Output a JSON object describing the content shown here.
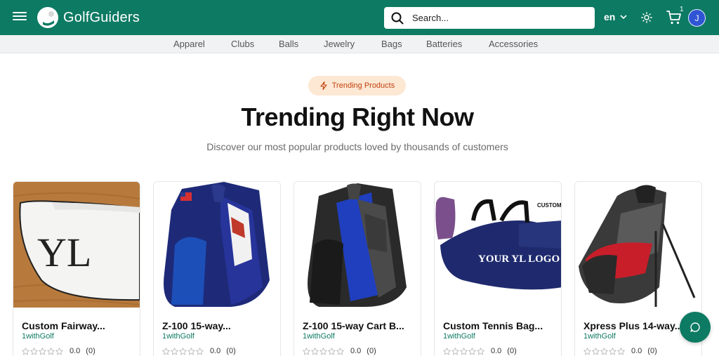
{
  "header": {
    "brand": "GolfGuiders",
    "search_placeholder": "Search...",
    "language": "en",
    "cart_count": "1",
    "avatar_initial": "J",
    "brand_color": "#0d7a63"
  },
  "categories": [
    "Apparel",
    "Clubs",
    "Balls",
    "Jewelry",
    "Bags",
    "Batteries",
    "Accessories"
  ],
  "hero": {
    "badge": "Trending Products",
    "title": "Trending Right Now",
    "subtitle": "Discover our most popular products loved by thousands of customers"
  },
  "products": [
    {
      "name": "Custom Fairway...",
      "brand": "1withGolf",
      "rating": "0.0",
      "reviews": "(0)",
      "image": "headcover-photo"
    },
    {
      "name": "Z-100 15-way...",
      "brand": "1withGolf",
      "rating": "0.0",
      "reviews": "(0)",
      "image": "navy-cart-bag"
    },
    {
      "name": "Z-100 15-way Cart B...",
      "brand": "1withGolf",
      "rating": "0.0",
      "reviews": "(0)",
      "image": "blue-black-cart-bag"
    },
    {
      "name": "Custom Tennis Bag...",
      "brand": "1withGolf",
      "rating": "0.0",
      "reviews": "(0)",
      "image": "tennis-bag",
      "image_text": {
        "top": "CUSTOM",
        "logo": "YOUR YL LOGO"
      }
    },
    {
      "name": "Xpress Plus 14-way...",
      "brand": "1withGolf",
      "rating": "0.0",
      "reviews": "(0)",
      "image": "red-stand-bag"
    }
  ],
  "icons": [
    "menu-icon",
    "search-icon",
    "chevron-down-icon",
    "sun-icon",
    "cart-icon",
    "sparkle-icon",
    "star-icon",
    "chat-icon"
  ]
}
